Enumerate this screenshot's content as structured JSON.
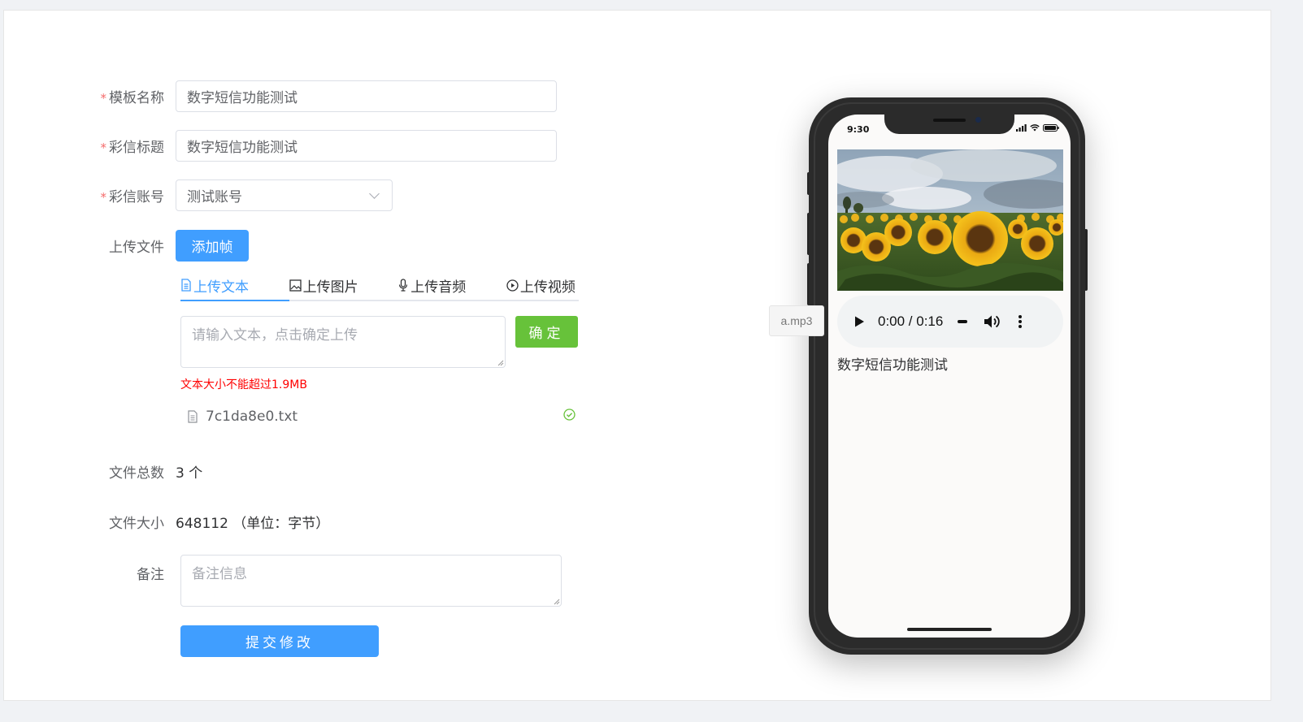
{
  "form": {
    "template_name": {
      "label": "模板名称",
      "required": true,
      "value": "数字短信功能测试"
    },
    "mms_title": {
      "label": "彩信标题",
      "required": true,
      "value": "数字短信功能测试"
    },
    "mms_account": {
      "label": "彩信账号",
      "required": true,
      "value": "测试账号"
    },
    "upload": {
      "label": "上传文件",
      "add_frame_button": "添加帧",
      "tabs": [
        {
          "label": "上传文本",
          "icon": "document-icon",
          "active": true
        },
        {
          "label": "上传图片",
          "icon": "image-icon",
          "active": false
        },
        {
          "label": "上传音频",
          "icon": "microphone-icon",
          "active": false
        },
        {
          "label": "上传视频",
          "icon": "play-circle-icon",
          "active": false
        }
      ],
      "text_placeholder": "请输入文本，点击确定上传",
      "confirm_button": "确定",
      "size_hint": "文本大小不能超过1.9MB",
      "file_name": "7c1da8e0.txt"
    },
    "file_count": {
      "label": "文件总数",
      "value": "3 个"
    },
    "file_size": {
      "label": "文件大小",
      "value": "648112 （单位：字节）"
    },
    "remark": {
      "label": "备注",
      "placeholder": "备注信息"
    },
    "submit_button": "提交修改"
  },
  "preview": {
    "status_time": "9:30",
    "audio_file_tag": "a.mp3",
    "audio_time": "0:00 / 0:16",
    "caption": "数字短信功能测试"
  },
  "colors": {
    "primary": "#409eff",
    "success": "#67c23a",
    "required": "#f56c6c",
    "error": "#ff0000"
  }
}
